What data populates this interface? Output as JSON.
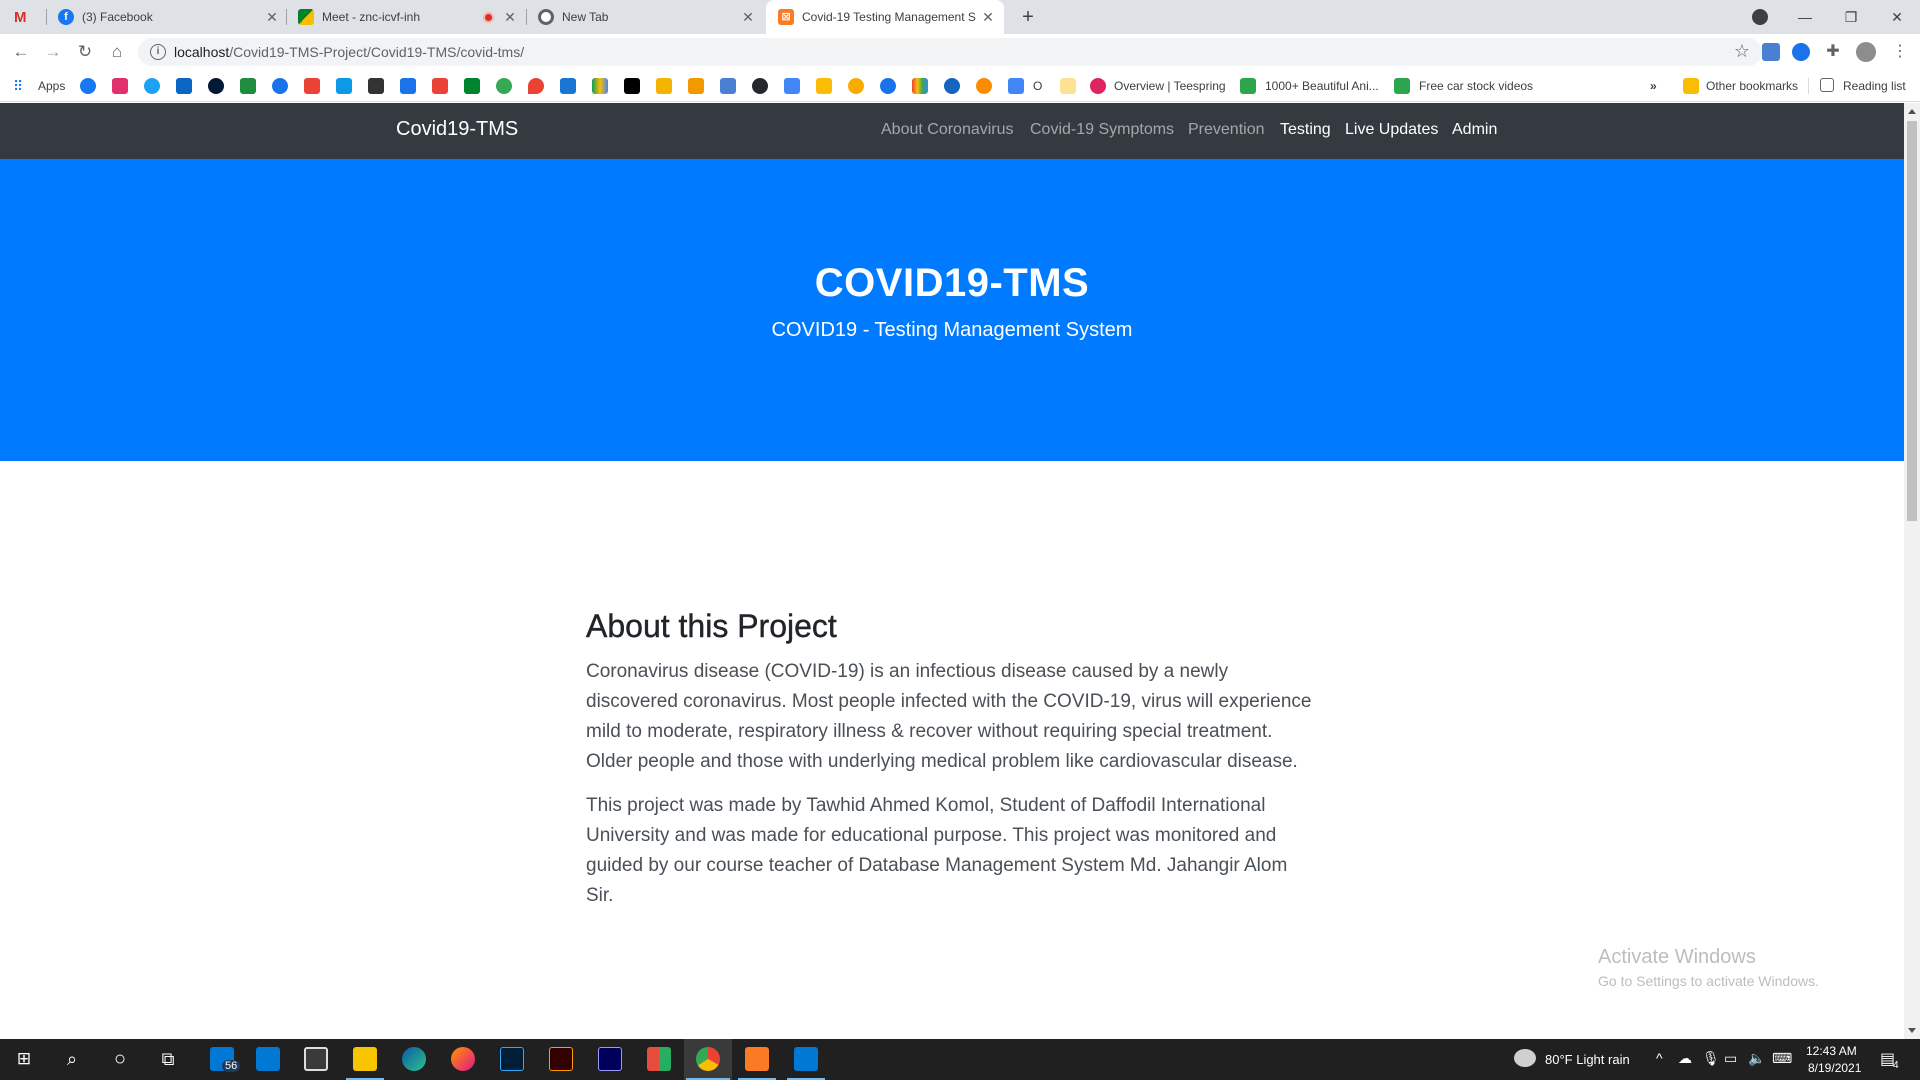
{
  "browser": {
    "tabs": [
      {
        "title": "",
        "icon": "gmail-icon"
      },
      {
        "title": "(3) Facebook",
        "icon": "facebook-icon"
      },
      {
        "title": "Meet - znc-icvf-inh",
        "icon": "meet-icon",
        "recording": true
      },
      {
        "title": "New Tab",
        "icon": "chrome-icon"
      },
      {
        "title": "Covid-19 Testing Management S",
        "icon": "xampp-icon",
        "active": true
      }
    ],
    "url_host": "localhost",
    "url_path": "/Covid19-TMS-Project/Covid19-TMS/covid-tms/",
    "bookmarks": {
      "apps_label": "Apps",
      "item_o": "O",
      "teespring": "Overview | Teespring",
      "beautiful": "1000+ Beautiful Ani...",
      "car_videos": "Free car stock videos",
      "other": "Other bookmarks",
      "reading": "Reading list"
    }
  },
  "site": {
    "brand": "Covid19-TMS",
    "nav": [
      {
        "label": "About Coronavirus",
        "active": false
      },
      {
        "label": "Covid-19 Symptoms",
        "active": false
      },
      {
        "label": "Prevention",
        "active": false
      },
      {
        "label": "Testing",
        "active": true
      },
      {
        "label": "Live Updates",
        "active": true
      },
      {
        "label": "Admin",
        "active": true
      }
    ],
    "hero": {
      "title": "COVID19-TMS",
      "subtitle": "COVID19 - Testing Management System",
      "bg_color": "#007bff"
    },
    "about": {
      "heading": "About this Project",
      "paragraphs": [
        "Coronavirus disease (COVID-19) is an infectious disease caused by a newly discovered coronavirus. Most people infected with the COVID-19, virus will experience mild to moderate, respiratory illness & recover without requiring special treatment. Older people and those with underlying medical problem like cardiovascular disease.",
        "This project was made by Tawhid Ahmed Komol, Student of Daffodil International University and was made for educational purpose. This project was monitored and guided by our course teacher of Database Management System Md. Jahangir Alom Sir."
      ]
    }
  },
  "windows": {
    "activate_title": "Activate Windows",
    "activate_sub": "Go to Settings to activate Windows.",
    "mail_badge": "56",
    "weather": "80°F  Light rain",
    "time": "12:43 AM",
    "date": "8/19/2021",
    "notif_count": "4"
  }
}
